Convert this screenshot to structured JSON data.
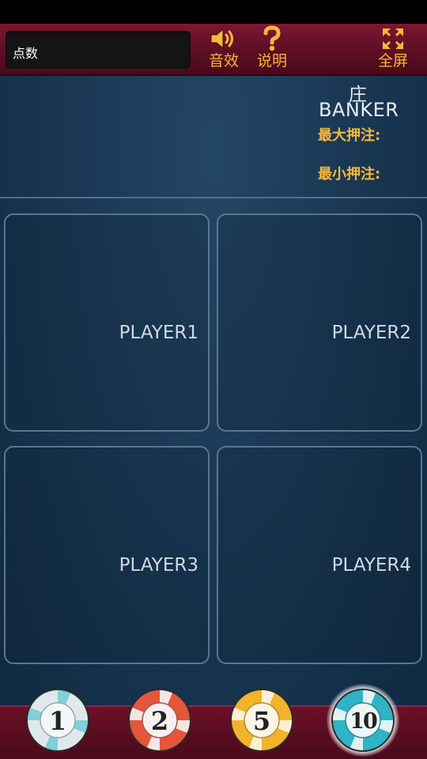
{
  "header": {
    "points_label": "点数",
    "sound_label": "音效",
    "help_label": "说明",
    "fullscreen_label": "全屏"
  },
  "banker": {
    "title_cn": "庄",
    "title_en": "BANKER",
    "max_bet_label": "最大押注:",
    "min_bet_label": "最小押注:"
  },
  "players": [
    {
      "label": "PLAYER1"
    },
    {
      "label": "PLAYER2"
    },
    {
      "label": "PLAYER3"
    },
    {
      "label": "PLAYER4"
    }
  ],
  "chips": [
    {
      "value": "1",
      "color": "#7fd0d8",
      "selected": false
    },
    {
      "value": "2",
      "color": "#e4553a",
      "selected": false
    },
    {
      "value": "5",
      "color": "#f3b32a",
      "selected": false
    },
    {
      "value": "10",
      "color": "#2fb3c6",
      "selected": true
    }
  ],
  "colors": {
    "accent": "#f6b73c",
    "header_bg": "#6b1028",
    "table_bg": "#1a3854"
  }
}
